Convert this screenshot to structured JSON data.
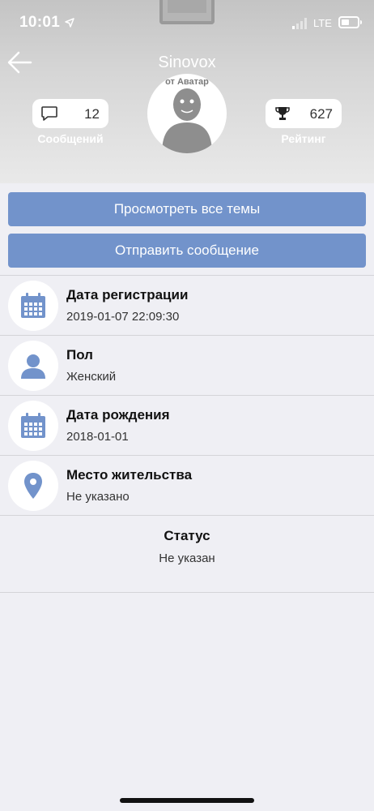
{
  "status_bar": {
    "time": "10:01",
    "network": "LTE"
  },
  "profile": {
    "username": "Sinovox",
    "avatar_caption": "от Аватар",
    "messages": {
      "count": "12",
      "label": "Сообщений"
    },
    "rating": {
      "value": "627",
      "label": "Рейтинг"
    }
  },
  "actions": {
    "view_topics": "Просмотреть все темы",
    "send_message": "Отправить сообщение"
  },
  "info": [
    {
      "title": "Дата регистрации",
      "value": "2019-01-07 22:09:30",
      "icon": "calendar-icon"
    },
    {
      "title": "Пол",
      "value": "Женский",
      "icon": "person-icon"
    },
    {
      "title": "Дата рождения",
      "value": "2018-01-01",
      "icon": "calendar-icon"
    },
    {
      "title": "Место жительства",
      "value": "Не указано",
      "icon": "location-pin-icon"
    }
  ],
  "status": {
    "title": "Статус",
    "value": "Не указан"
  },
  "colors": {
    "accent": "#7293cb",
    "background": "#efeff4"
  }
}
